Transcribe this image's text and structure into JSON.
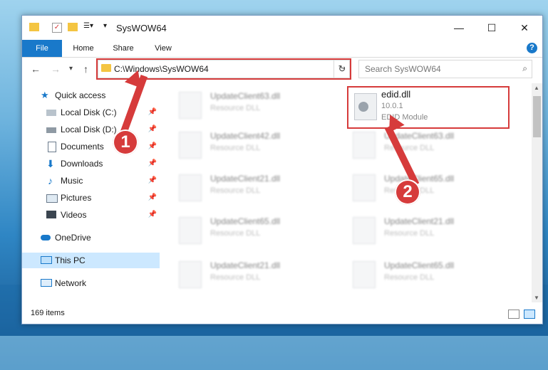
{
  "window": {
    "title": "SysWOW64"
  },
  "ribbon": {
    "file": "File",
    "home": "Home",
    "share": "Share",
    "view": "View"
  },
  "address": {
    "path": "C:\\Windows\\SysWOW64"
  },
  "search": {
    "placeholder": "Search SysWOW64"
  },
  "sidebar": {
    "items": [
      {
        "label": "Quick access"
      },
      {
        "label": "Local Disk (C:)"
      },
      {
        "label": "Local Disk (D:)"
      },
      {
        "label": "Documents"
      },
      {
        "label": "Downloads"
      },
      {
        "label": "Music"
      },
      {
        "label": "Pictures"
      },
      {
        "label": "Videos"
      },
      {
        "label": "OneDrive"
      },
      {
        "label": "This PC"
      },
      {
        "label": "Network"
      }
    ]
  },
  "files": [
    {
      "name": "UpdateClient63.dll",
      "desc": "Resource DLL"
    },
    {
      "name": "edid.dll",
      "version": "10.0.1",
      "desc": "EDID Module"
    },
    {
      "name": "UpdateClient42.dll",
      "desc": "Resource DLL"
    },
    {
      "name": "UpdateClient63.dll",
      "desc": "Resource DLL"
    },
    {
      "name": "UpdateClient21.dll",
      "desc": "Resource DLL"
    },
    {
      "name": "UpdateClient65.dll",
      "desc": "Resource DLL"
    },
    {
      "name": "UpdateClient65.dll",
      "desc": "Resource DLL"
    },
    {
      "name": "UpdateClient21.dll",
      "desc": "Resource DLL"
    },
    {
      "name": "UpdateClient21.dll",
      "desc": "Resource DLL"
    },
    {
      "name": "UpdateClient65.dll",
      "desc": "Resource DLL"
    }
  ],
  "status": {
    "count": "169 items"
  },
  "annotations": {
    "step1": "1",
    "step2": "2"
  },
  "colors": {
    "accent": "#1979ca",
    "highlight": "#d63b3b",
    "selected": "#cce8ff"
  }
}
